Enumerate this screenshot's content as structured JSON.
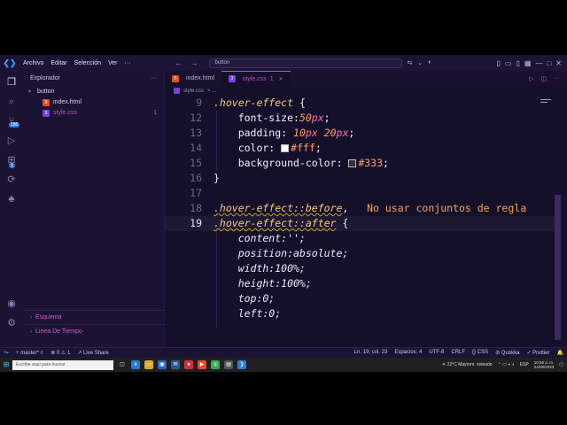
{
  "menu": [
    "Archivo",
    "Editar",
    "Selección",
    "Ver"
  ],
  "command_center": "button",
  "sidebar": {
    "title": "Explorador",
    "more": "···",
    "folder": "button",
    "files": [
      {
        "name": "index.html",
        "type": "html"
      },
      {
        "name": "style.css",
        "type": "css",
        "modified": "1"
      }
    ],
    "outline": "Esquema",
    "timeline": "Linea De Tiempo"
  },
  "activity_badges": {
    "ext": "186",
    "scm": "1"
  },
  "tabs": [
    {
      "label": "index.html",
      "type": "html",
      "active": false
    },
    {
      "label": "style.css",
      "type": "css",
      "active": true,
      "badge": "1"
    }
  ],
  "breadcrumb": {
    "file": "style.css",
    "sep": "> ..."
  },
  "editor": {
    "lines": [
      {
        "n": "9",
        "tokens": [
          {
            "t": ".hover-effect",
            "c": "sel"
          },
          {
            "t": " {",
            "c": "prop"
          }
        ]
      },
      {
        "n": "12",
        "tokens": [
          {
            "t": "    font-size:",
            "c": "prop"
          },
          {
            "t": "50",
            "c": "num"
          },
          {
            "t": "px",
            "c": "unit"
          },
          {
            "t": ";",
            "c": "prop"
          }
        ]
      },
      {
        "n": "13",
        "tokens": [
          {
            "t": "    padding: ",
            "c": "prop"
          },
          {
            "t": "10",
            "c": "num"
          },
          {
            "t": "px ",
            "c": "unit"
          },
          {
            "t": "20",
            "c": "num"
          },
          {
            "t": "px",
            "c": "unit"
          },
          {
            "t": ";",
            "c": "prop"
          }
        ]
      },
      {
        "n": "14",
        "tokens": [
          {
            "t": "    color: ",
            "c": "prop"
          },
          {
            "t": "#fff",
            "c": "val-str",
            "swatch": "#ffffff"
          },
          {
            "t": ";",
            "c": "prop"
          }
        ]
      },
      {
        "n": "15",
        "tokens": [
          {
            "t": "    background-color: ",
            "c": "prop"
          },
          {
            "t": "#333",
            "c": "val-str",
            "swatch": "#333333"
          },
          {
            "t": ";",
            "c": "prop"
          }
        ]
      },
      {
        "n": "16",
        "tokens": [
          {
            "t": "}",
            "c": "prop"
          }
        ]
      },
      {
        "n": "17",
        "tokens": []
      },
      {
        "n": "18",
        "tokens": [
          {
            "t": ".hover-effect::before",
            "c": "sel",
            "squiggle": true
          },
          {
            "t": ",",
            "c": "prop"
          },
          {
            "t": "   No usar conjuntos de regla",
            "c": "lint"
          }
        ]
      },
      {
        "n": "19",
        "tokens": [
          {
            "t": ".hover-effect::after",
            "c": "sel",
            "squiggle": true
          },
          {
            "t": " {",
            "c": "prop"
          }
        ],
        "current": true
      },
      {
        "n": "",
        "tokens": [
          {
            "t": "    content:'';",
            "c": "italic-dim"
          }
        ]
      },
      {
        "n": "",
        "tokens": [
          {
            "t": "    position:absolute;",
            "c": "italic-dim"
          }
        ]
      },
      {
        "n": "",
        "tokens": [
          {
            "t": "    width:100%;",
            "c": "italic-dim"
          }
        ]
      },
      {
        "n": "",
        "tokens": [
          {
            "t": "    height:100%;",
            "c": "italic-dim"
          }
        ]
      },
      {
        "n": "",
        "tokens": [
          {
            "t": "    top:0;",
            "c": "italic-dim"
          }
        ]
      },
      {
        "n": "",
        "tokens": [
          {
            "t": "    left:0;",
            "c": "italic-dim"
          }
        ]
      }
    ]
  },
  "status": {
    "branch": "master*",
    "errors": "0",
    "warnings": "1",
    "live_share": "Live Share",
    "position": "Ln. 19, col. 23",
    "spaces": "Espacios: 4",
    "encoding": "UTF-8",
    "eol": "CRLF",
    "language": "CSS",
    "quokka": "Quokka",
    "prettier": "Prettier"
  },
  "taskbar": {
    "search_placeholder": "Escribe aquí para buscar",
    "weather": "22°C  Mayorm. soleado",
    "lang": "ESP",
    "time": "10:56 a. m.",
    "date": "24/08/2023"
  },
  "colors": {
    "accent": "#c94ac8",
    "background": "#15102a",
    "sidebar": "#1a1432",
    "selector": "#f6c87c",
    "number": "#ff9e64"
  }
}
